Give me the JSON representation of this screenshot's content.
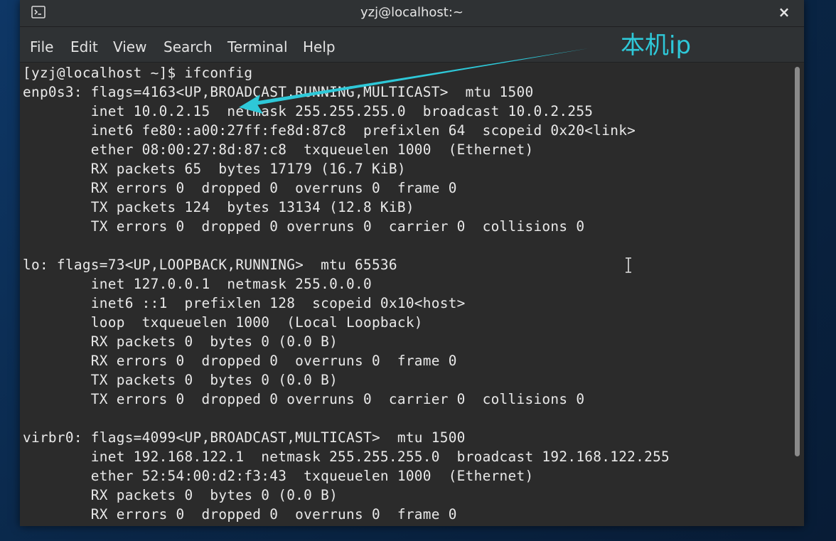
{
  "window": {
    "title": "yzj@localhost:~",
    "close_label": "×"
  },
  "menu": {
    "items": [
      "File",
      "Edit",
      "View",
      "Search",
      "Terminal",
      "Help"
    ]
  },
  "terminal": {
    "lines": [
      "[yzj@localhost ~]$ ifconfig",
      "enp0s3: flags=4163<UP,BROADCAST,RUNNING,MULTICAST>  mtu 1500",
      "        inet 10.0.2.15  netmask 255.255.255.0  broadcast 10.0.2.255",
      "        inet6 fe80::a00:27ff:fe8d:87c8  prefixlen 64  scopeid 0x20<link>",
      "        ether 08:00:27:8d:87:c8  txqueuelen 1000  (Ethernet)",
      "        RX packets 65  bytes 17179 (16.7 KiB)",
      "        RX errors 0  dropped 0  overruns 0  frame 0",
      "        TX packets 124  bytes 13134 (12.8 KiB)",
      "        TX errors 0  dropped 0 overruns 0  carrier 0  collisions 0",
      "",
      "lo: flags=73<UP,LOOPBACK,RUNNING>  mtu 65536",
      "        inet 127.0.0.1  netmask 255.0.0.0",
      "        inet6 ::1  prefixlen 128  scopeid 0x10<host>",
      "        loop  txqueuelen 1000  (Local Loopback)",
      "        RX packets 0  bytes 0 (0.0 B)",
      "        RX errors 0  dropped 0  overruns 0  frame 0",
      "        TX packets 0  bytes 0 (0.0 B)",
      "        TX errors 0  dropped 0 overruns 0  carrier 0  collisions 0",
      "",
      "virbr0: flags=4099<UP,BROADCAST,MULTICAST>  mtu 1500",
      "        inet 192.168.122.1  netmask 255.255.255.0  broadcast 192.168.122.255",
      "        ether 52:54:00:d2:f3:43  txqueuelen 1000  (Ethernet)",
      "        RX packets 0  bytes 0 (0.0 B)",
      "        RX errors 0  dropped 0  overruns 0  frame 0"
    ]
  },
  "annotation": {
    "text": "本机ip",
    "color": "#2ec8d8"
  },
  "colors": {
    "terminal_bg": "#2b2b2b",
    "terminal_fg": "#e9e9e9",
    "titlebar_bg": "#2f3234"
  }
}
